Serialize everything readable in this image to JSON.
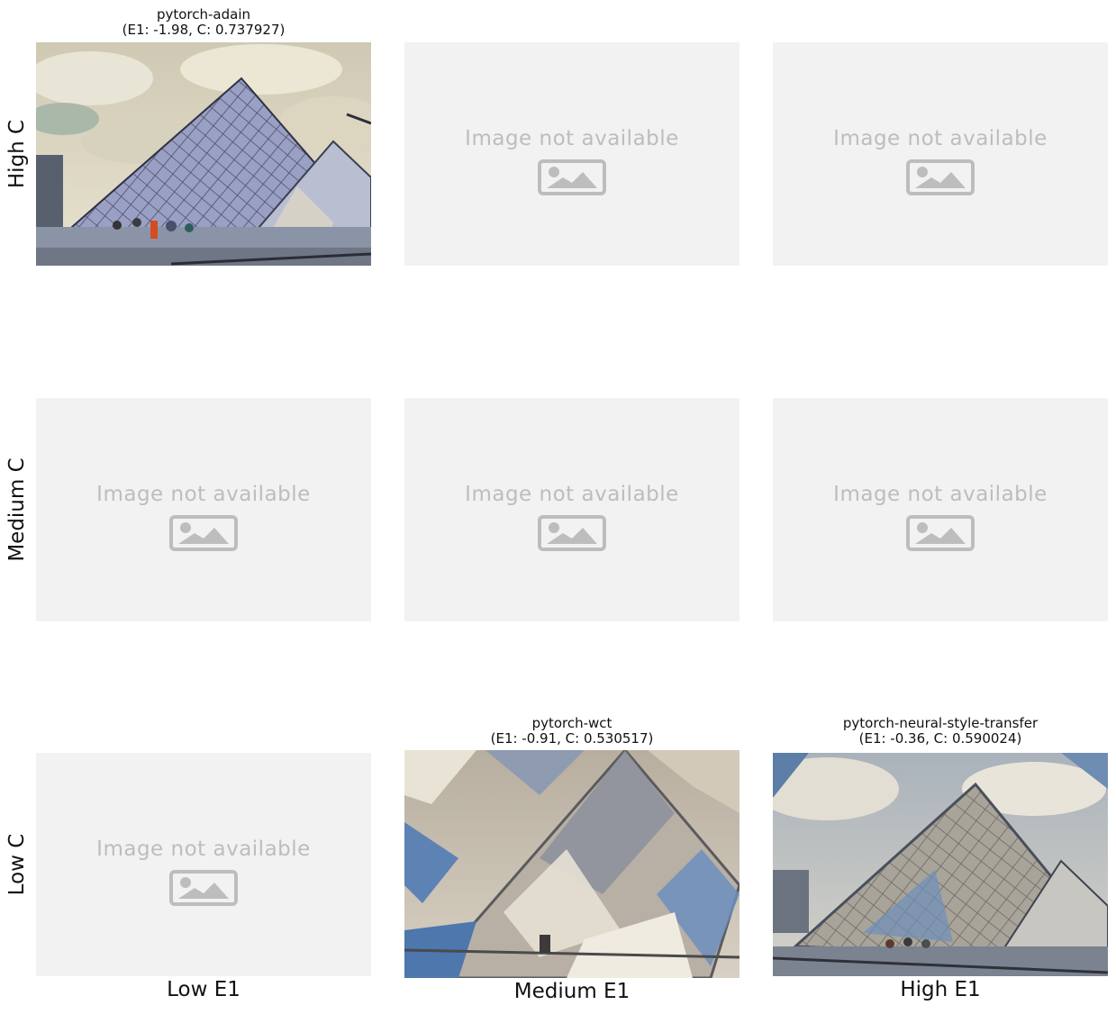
{
  "row_labels": [
    "High C",
    "Medium C",
    "Low C"
  ],
  "col_labels": [
    "Low E1",
    "Medium E1",
    "High E1"
  ],
  "placeholder_text": "Image not available",
  "cells": {
    "high_low": {
      "title_line1": "pytorch-adain",
      "title_line2": "(E1: -1.98, C: 0.737927)"
    },
    "low_medium": {
      "title_line1": "pytorch-wct",
      "title_line2": "(E1: -0.91, C: 0.530517)"
    },
    "low_high": {
      "title_line1": "pytorch-neural-style-transfer",
      "title_line2": "(E1: -0.36, C: 0.590024)"
    }
  },
  "colors": {
    "placeholder_bg": "#f2f2f2",
    "placeholder_fg": "#bdbdbd"
  },
  "icons": [
    "image-placeholder-icon"
  ]
}
